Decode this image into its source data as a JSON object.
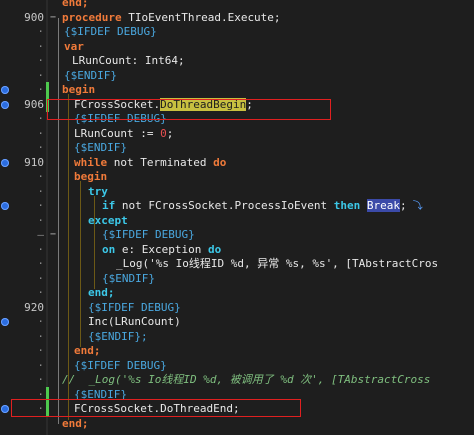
{
  "gutter": {
    "line_900": "900",
    "line_906": "906",
    "line_910": "910",
    "line_920": "920",
    "dot": "·",
    "dash": "—"
  },
  "code": [
    {
      "kind": "end_top",
      "text": "end;"
    },
    {
      "kind": "proc",
      "kw": "procedure",
      "rest": " TIoEventThread.Execute;"
    },
    {
      "kind": "dir",
      "text": "{$IFDEF DEBUG}"
    },
    {
      "kind": "kw",
      "text": "var"
    },
    {
      "kind": "plain",
      "text": "LRunCount: Int64;"
    },
    {
      "kind": "dir",
      "text": "{$ENDIF}"
    },
    {
      "kind": "kw",
      "text": "begin"
    },
    {
      "kind": "call",
      "obj": "FCrossSocket.",
      "method": "DoThreadBegin",
      "tail": ";"
    },
    {
      "kind": "dir",
      "text": "{$IFDEF DEBUG}"
    },
    {
      "kind": "assign",
      "lhs": "LRunCount := ",
      "num": "0",
      "tail": ";"
    },
    {
      "kind": "dir",
      "text": "{$ENDIF}"
    },
    {
      "kind": "while",
      "kw1": "while",
      "mid": " not Terminated ",
      "kw2": "do"
    },
    {
      "kind": "kw",
      "text": "begin"
    },
    {
      "kind": "kw2",
      "text": "try"
    },
    {
      "kind": "if",
      "kw1": "if",
      "mid": " not FCrossSocket.ProcessIoEvent ",
      "kw2": "then",
      "brk": "Break",
      "tail": ";"
    },
    {
      "kind": "kw2",
      "text": "except"
    },
    {
      "kind": "dir",
      "text": "{$IFDEF DEBUG}"
    },
    {
      "kind": "on",
      "kw1": "on",
      "mid": " e: Exception ",
      "kw2": "do"
    },
    {
      "kind": "log",
      "text": "_Log('%s Io线程ID %d, 异常 %s, %s', [TAbstractCros"
    },
    {
      "kind": "dir",
      "text": "{$ENDIF}"
    },
    {
      "kind": "kw2",
      "text": "end;"
    },
    {
      "kind": "dir",
      "text": "{$IFDEF DEBUG}"
    },
    {
      "kind": "plain",
      "text": "Inc(LRunCount)"
    },
    {
      "kind": "dir",
      "text": "{$ENDIF};"
    },
    {
      "kind": "kw",
      "text": "end;"
    },
    {
      "kind": "dir",
      "text": "{$IFDEF DEBUG}"
    },
    {
      "kind": "comment",
      "text": "//  _Log('%s Io线程ID %d, 被调用了 %d 次', [TAbstractCross"
    },
    {
      "kind": "dir",
      "text": "{$ENDIF}"
    },
    {
      "kind": "call2",
      "text": "FCrossSocket.DoThreadEnd;"
    },
    {
      "kind": "end_bottom",
      "text": "end;"
    }
  ],
  "colors": {
    "background": "#1e1e1e",
    "keyword": "#f07a3a",
    "directive": "#4aa8e0",
    "try_except": "#3cc8e8",
    "highlight": "#c8c040",
    "selection_break": "#3b4aa8",
    "annotation_box": "#e02020",
    "modified_bar": "#4ec94e",
    "breakpoint": "#2b6de0"
  }
}
